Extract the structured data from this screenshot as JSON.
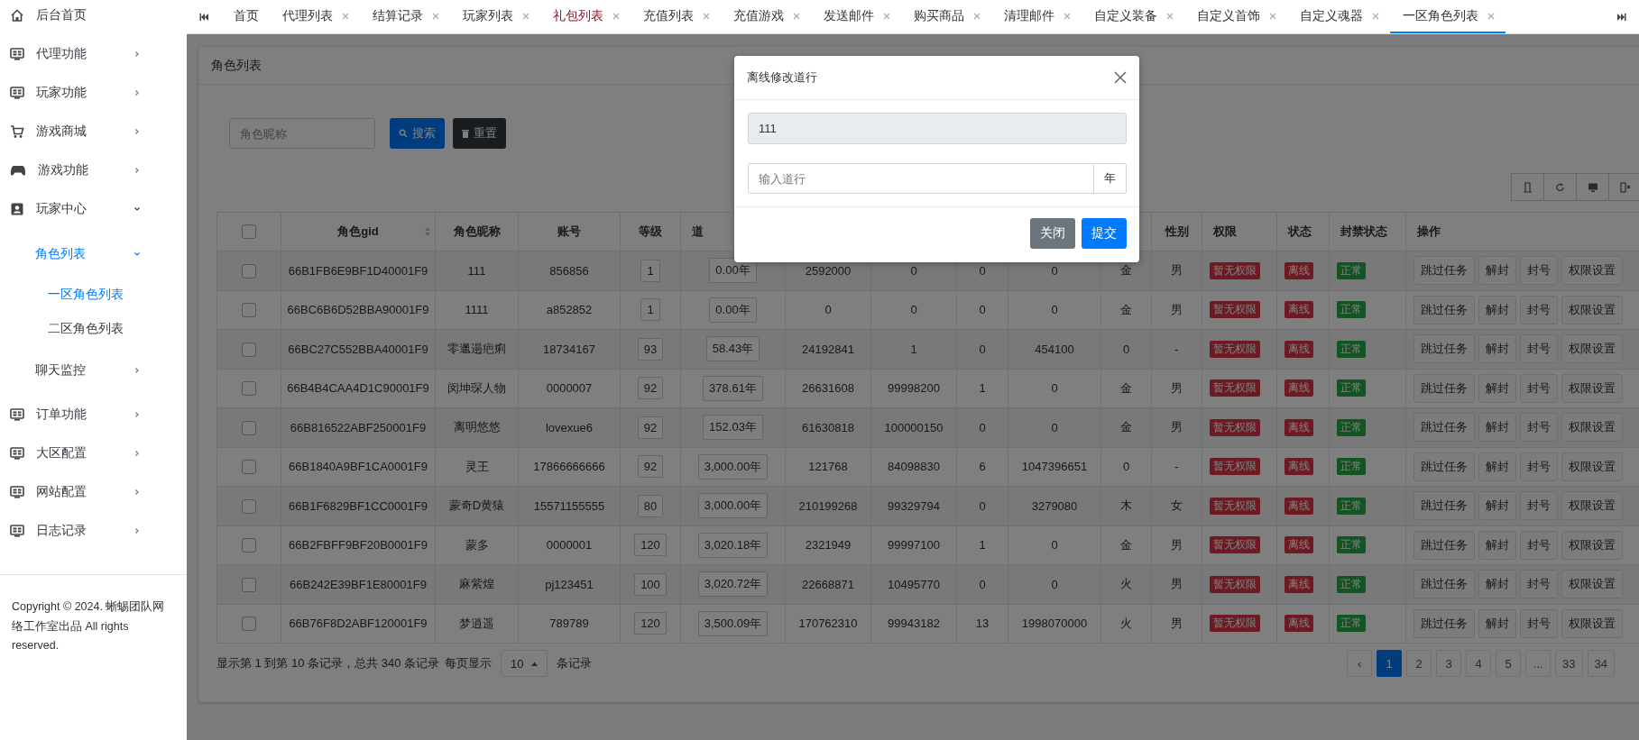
{
  "sidebar": {
    "items": [
      {
        "label": "后台首页",
        "selected": false
      },
      {
        "label": "代理功能",
        "expanded": false,
        "selected": false
      },
      {
        "label": "玩家功能",
        "expanded": false,
        "selected": false
      },
      {
        "label": "游戏商城",
        "expanded": false,
        "selected": false
      },
      {
        "label": "游戏功能",
        "expanded": false,
        "selected": false
      },
      {
        "label": "玩家中心",
        "expanded": true,
        "selected": false,
        "children": [
          {
            "label": "角色列表",
            "expanded": true,
            "selected": true,
            "children": [
              {
                "label": "一区角色列表",
                "selected": true
              },
              {
                "label": "二区角色列表",
                "selected": false
              }
            ]
          },
          {
            "label": "聊天监控",
            "expanded": false,
            "selected": false
          }
        ]
      },
      {
        "label": "订单功能",
        "expanded": false,
        "selected": false
      },
      {
        "label": "大区配置",
        "expanded": false,
        "selected": false
      },
      {
        "label": "网站配置",
        "expanded": false,
        "selected": false
      },
      {
        "label": "日志记录",
        "expanded": false,
        "selected": false
      }
    ],
    "copyright": "Copyright © 2024. 蜥蜴团队网络工作室出品 All rights reserved."
  },
  "tabs": [
    {
      "label": "首页",
      "closable": false,
      "selected": false,
      "hovered": false
    },
    {
      "label": "代理列表",
      "closable": true,
      "selected": false,
      "hovered": false
    },
    {
      "label": "结算记录",
      "closable": true,
      "selected": false,
      "hovered": false
    },
    {
      "label": "玩家列表",
      "closable": true,
      "selected": false,
      "hovered": false
    },
    {
      "label": "礼包列表",
      "closable": true,
      "selected": false,
      "hovered": true
    },
    {
      "label": "充值列表",
      "closable": true,
      "selected": false,
      "hovered": false
    },
    {
      "label": "充值游戏",
      "closable": true,
      "selected": false,
      "hovered": false
    },
    {
      "label": "发送邮件",
      "closable": true,
      "selected": false,
      "hovered": false
    },
    {
      "label": "购买商品",
      "closable": true,
      "selected": false,
      "hovered": false
    },
    {
      "label": "清理邮件",
      "closable": true,
      "selected": false,
      "hovered": false
    },
    {
      "label": "自定义装备",
      "closable": true,
      "selected": false,
      "hovered": false
    },
    {
      "label": "自定义首饰",
      "closable": true,
      "selected": false,
      "hovered": false
    },
    {
      "label": "自定义魂器",
      "closable": true,
      "selected": false,
      "hovered": false
    },
    {
      "label": "一区角色列表",
      "closable": true,
      "selected": true,
      "hovered": false
    }
  ],
  "card": {
    "title": "角色列表",
    "search": {
      "placeholder": "角色昵称",
      "buttons": [
        {
          "kind": "search",
          "label": "搜索"
        },
        {
          "kind": "reset",
          "label": "重置"
        }
      ]
    },
    "table": {
      "select_all": {
        "checked": false
      },
      "columns": [
        {
          "label": "角色gid",
          "sortable": true
        },
        {
          "label": "角色昵称"
        },
        {
          "label": "账号"
        },
        {
          "label": "等级"
        },
        {
          "label": "道"
        },
        {},
        {},
        {},
        {},
        {},
        {
          "label": "性别"
        },
        {
          "label": "权限"
        },
        {
          "label": "状态"
        },
        {
          "label": "封禁状态"
        },
        {
          "label": "操作"
        }
      ],
      "rows": [
        {
          "selected": false,
          "gid": "66B1FB6E9BF1D40001F9",
          "nickname": "111",
          "account": "856856",
          "grade": "1",
          "daoxing": "0.00年",
          "column_7": "2592000",
          "column_8": "0",
          "column_9": "0",
          "column_10": "0",
          "column_11": "金",
          "gender": "男",
          "permission": "暂无权限",
          "status": "离线",
          "ban_status": "正常",
          "actions": [
            "跳过任务",
            "解封",
            "封号",
            "权限设置"
          ]
        },
        {
          "selected": false,
          "gid": "66BC6B6D52BBA90001F9",
          "nickname": "1111",
          "account": "a852852",
          "grade": "1",
          "daoxing": "0.00年",
          "column_7": "0",
          "column_8": "0",
          "column_9": "0",
          "column_10": "0",
          "column_11": "金",
          "gender": "男",
          "permission": "暂无权限",
          "status": "离线",
          "ban_status": "正常",
          "actions": [
            "跳过任务",
            "解封",
            "封号",
            "权限设置"
          ]
        },
        {
          "selected": false,
          "gid": "66BC27C552BBA40001F9",
          "nickname": "零邋遢疤痢",
          "account": "18734167",
          "grade": "93",
          "daoxing": "58.43年",
          "column_7": "24192841",
          "column_8": "1",
          "column_9": "0",
          "column_10": "454100",
          "column_11": "0",
          "gender": "-",
          "permission": "暂无权限",
          "status": "离线",
          "ban_status": "正常",
          "actions": [
            "跳过任务",
            "解封",
            "封号",
            "权限设置"
          ]
        },
        {
          "selected": false,
          "gid": "66B4B4CAA4D1C90001F9",
          "nickname": "闵坤琛人物",
          "account": "0000007",
          "grade": "92",
          "daoxing": "378.61年",
          "column_7": "26631608",
          "column_8": "99998200",
          "column_9": "1",
          "column_10": "0",
          "column_11": "金",
          "gender": "男",
          "permission": "暂无权限",
          "status": "离线",
          "ban_status": "正常",
          "actions": [
            "跳过任务",
            "解封",
            "封号",
            "权限设置"
          ]
        },
        {
          "selected": false,
          "gid": "66B816522ABF250001F9",
          "nickname": "离明悠悠",
          "account": "lovexue6",
          "grade": "92",
          "daoxing": "152.03年",
          "column_7": "61630818",
          "column_8": "100000150",
          "column_9": "0",
          "column_10": "0",
          "column_11": "金",
          "gender": "男",
          "permission": "暂无权限",
          "status": "离线",
          "ban_status": "正常",
          "actions": [
            "跳过任务",
            "解封",
            "封号",
            "权限设置"
          ]
        },
        {
          "selected": false,
          "gid": "66B1840A9BF1CA0001F9",
          "nickname": "灵王",
          "account": "17866666666",
          "grade": "92",
          "daoxing": "3,000.00年",
          "column_7": "121768",
          "column_8": "84098830",
          "column_9": "6",
          "column_10": "1047396651",
          "column_11": "0",
          "gender": "-",
          "permission": "暂无权限",
          "status": "离线",
          "ban_status": "正常",
          "actions": [
            "跳过任务",
            "解封",
            "封号",
            "权限设置"
          ]
        },
        {
          "selected": false,
          "gid": "66B1F6829BF1CC0001F9",
          "nickname": "蒙奇D黄猿",
          "account": "15571155555",
          "grade": "80",
          "daoxing": "3,000.00年",
          "column_7": "210199268",
          "column_8": "99329794",
          "column_9": "0",
          "column_10": "3279080",
          "column_11": "木",
          "gender": "女",
          "permission": "暂无权限",
          "status": "离线",
          "ban_status": "正常",
          "actions": [
            "跳过任务",
            "解封",
            "封号",
            "权限设置"
          ]
        },
        {
          "selected": false,
          "gid": "66B2FBFF9BF20B0001F9",
          "nickname": "蒙多",
          "account": "0000001",
          "grade": "120",
          "daoxing": "3,020.18年",
          "column_7": "2321949",
          "column_8": "99997100",
          "column_9": "1",
          "column_10": "0",
          "column_11": "金",
          "gender": "男",
          "permission": "暂无权限",
          "status": "离线",
          "ban_status": "正常",
          "actions": [
            "跳过任务",
            "解封",
            "封号",
            "权限设置"
          ]
        },
        {
          "selected": false,
          "gid": "66B242E39BF1E80001F9",
          "nickname": "麻紫煌",
          "account": "pj123451",
          "grade": "100",
          "daoxing": "3,020.72年",
          "column_7": "22668871",
          "column_8": "10495770",
          "column_9": "0",
          "column_10": "0",
          "column_11": "火",
          "gender": "男",
          "permission": "暂无权限",
          "status": "离线",
          "ban_status": "正常",
          "actions": [
            "跳过任务",
            "解封",
            "封号",
            "权限设置"
          ]
        },
        {
          "selected": false,
          "gid": "66B76F8D2ABF120001F9",
          "nickname": "梦逍遥",
          "account": "789789",
          "grade": "120",
          "daoxing": "3,500.09年",
          "column_7": "170762310",
          "column_8": "99943182",
          "column_9": "13",
          "column_10": "1998070000",
          "column_11": "火",
          "gender": "男",
          "permission": "暂无权限",
          "status": "离线",
          "ban_status": "正常",
          "actions": [
            "跳过任务",
            "解封",
            "封号",
            "权限设置"
          ]
        }
      ]
    },
    "footer": {
      "summary": "显示第 1 到第 10 条记录，总共 340 条记录",
      "page_size_label": "每页显示",
      "page_size": "10",
      "page_size_suffix": "条记录",
      "pages": [
        {
          "label": "‹",
          "selected": false
        },
        {
          "label": "1",
          "selected": true
        },
        {
          "label": "2",
          "selected": false
        },
        {
          "label": "3",
          "selected": false
        },
        {
          "label": "4",
          "selected": false
        },
        {
          "label": "5",
          "selected": false
        },
        {
          "label": "...",
          "selected": false
        },
        {
          "label": "33",
          "selected": false
        },
        {
          "label": "34",
          "selected": false
        }
      ]
    }
  },
  "dialog": {
    "title": "离线修改道行",
    "readonly_value": "111",
    "placeholder": "输入道行",
    "addon": "年",
    "buttons": [
      {
        "kind": "secondary",
        "label": "关闭"
      },
      {
        "kind": "primary",
        "label": "提交"
      }
    ]
  }
}
